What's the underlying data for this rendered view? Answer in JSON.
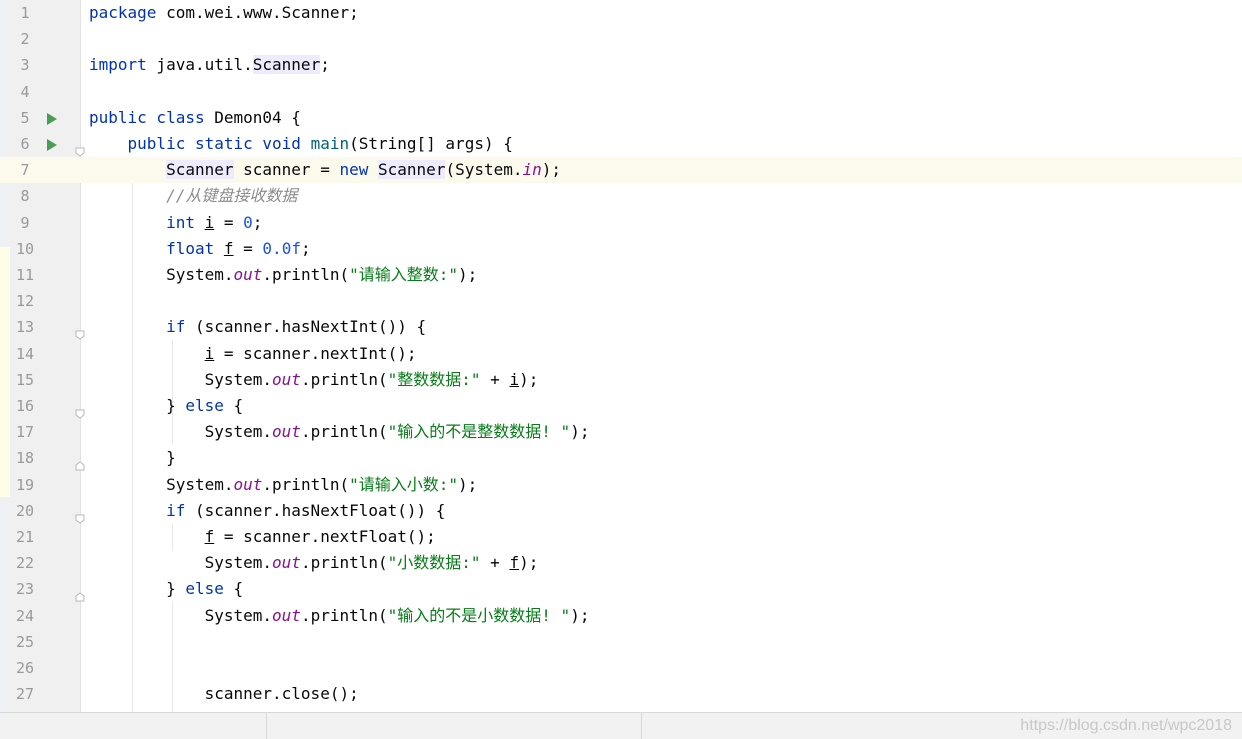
{
  "colors": {
    "keyword": "#0033b3",
    "string": "#067d17",
    "number": "#1750eb",
    "comment": "#8c8c8c",
    "static_field": "#871094",
    "method_decl": "#00627a",
    "plain": "#080808",
    "line_number": "#999999",
    "run_icon": "#499c54",
    "class_ref_bg": "#edebfc",
    "current_line_bg": "#fcfaed"
  },
  "editor": {
    "lines": [
      {
        "number": "1",
        "tokens": [
          {
            "t": "package",
            "c": "kw"
          },
          {
            "t": " com.wei.www.Scanner;"
          }
        ]
      },
      {
        "number": "2",
        "tokens": []
      },
      {
        "number": "3",
        "tokens": [
          {
            "t": "import",
            "c": "kw"
          },
          {
            "t": " java.util."
          },
          {
            "t": "Scanner",
            "c": "cls"
          },
          {
            "t": ";"
          }
        ]
      },
      {
        "number": "4",
        "tokens": []
      },
      {
        "number": "5",
        "run": true,
        "tokens": [
          {
            "t": "public class",
            "c": "kw"
          },
          {
            "t": " Demon04 {"
          }
        ]
      },
      {
        "number": "6",
        "run": true,
        "fold": "open",
        "tokens": [
          {
            "t": "    "
          },
          {
            "t": "public static void",
            "c": "kw"
          },
          {
            "t": " "
          },
          {
            "t": "main",
            "c": "mth"
          },
          {
            "t": "(String[] args) {"
          }
        ]
      },
      {
        "number": "7",
        "current": true,
        "tokens": [
          {
            "t": "        "
          },
          {
            "t": "Scanner",
            "c": "cls"
          },
          {
            "t": " scanner = "
          },
          {
            "t": "new",
            "c": "kw"
          },
          {
            "t": " "
          },
          {
            "t": "Scanner",
            "c": "cls"
          },
          {
            "t": "(System."
          },
          {
            "t": "in",
            "c": "sf"
          },
          {
            "t": ");"
          }
        ]
      },
      {
        "number": "8",
        "tokens": [
          {
            "t": "        "
          },
          {
            "t": "//从键盘接收数据",
            "c": "cm"
          }
        ]
      },
      {
        "number": "9",
        "tokens": [
          {
            "t": "        "
          },
          {
            "t": "int",
            "c": "kw"
          },
          {
            "t": " "
          },
          {
            "t": "i",
            "c": "ul"
          },
          {
            "t": " = "
          },
          {
            "t": "0",
            "c": "num"
          },
          {
            "t": ";"
          }
        ]
      },
      {
        "number": "10",
        "tokens": [
          {
            "t": "        "
          },
          {
            "t": "float",
            "c": "kw"
          },
          {
            "t": " "
          },
          {
            "t": "f",
            "c": "ul"
          },
          {
            "t": " = "
          },
          {
            "t": "0.0f",
            "c": "num"
          },
          {
            "t": ";"
          }
        ]
      },
      {
        "number": "11",
        "tokens": [
          {
            "t": "        System."
          },
          {
            "t": "out",
            "c": "sf"
          },
          {
            "t": ".println("
          },
          {
            "t": "\"请输入整数:\"",
            "c": "str"
          },
          {
            "t": ");"
          }
        ]
      },
      {
        "number": "12",
        "tokens": []
      },
      {
        "number": "13",
        "fold": "open",
        "tokens": [
          {
            "t": "        "
          },
          {
            "t": "if",
            "c": "kw"
          },
          {
            "t": " (scanner.hasNextInt()) {"
          }
        ]
      },
      {
        "number": "14",
        "tokens": [
          {
            "t": "            "
          },
          {
            "t": "i",
            "c": "ul"
          },
          {
            "t": " = scanner.nextInt();"
          }
        ]
      },
      {
        "number": "15",
        "tokens": [
          {
            "t": "            System."
          },
          {
            "t": "out",
            "c": "sf"
          },
          {
            "t": ".println("
          },
          {
            "t": "\"整数数据:\"",
            "c": "str"
          },
          {
            "t": " + "
          },
          {
            "t": "i",
            "c": "ul"
          },
          {
            "t": ");"
          }
        ]
      },
      {
        "number": "16",
        "fold": "open",
        "tokens": [
          {
            "t": "        } "
          },
          {
            "t": "else",
            "c": "kw"
          },
          {
            "t": " {"
          }
        ]
      },
      {
        "number": "17",
        "tokens": [
          {
            "t": "            System."
          },
          {
            "t": "out",
            "c": "sf"
          },
          {
            "t": ".println("
          },
          {
            "t": "\"输入的不是整数数据! \"",
            "c": "str"
          },
          {
            "t": ");"
          }
        ]
      },
      {
        "number": "18",
        "fold": "close",
        "tokens": [
          {
            "t": "        }"
          }
        ]
      },
      {
        "number": "19",
        "tokens": [
          {
            "t": "        System."
          },
          {
            "t": "out",
            "c": "sf"
          },
          {
            "t": ".println("
          },
          {
            "t": "\"请输入小数:\"",
            "c": "str"
          },
          {
            "t": ");"
          }
        ]
      },
      {
        "number": "20",
        "fold": "open",
        "tokens": [
          {
            "t": "        "
          },
          {
            "t": "if",
            "c": "kw"
          },
          {
            "t": " (scanner.hasNextFloat()) {"
          }
        ]
      },
      {
        "number": "21",
        "tokens": [
          {
            "t": "            "
          },
          {
            "t": "f",
            "c": "ul"
          },
          {
            "t": " = scanner.nextFloat();"
          }
        ]
      },
      {
        "number": "22",
        "tokens": [
          {
            "t": "            System."
          },
          {
            "t": "out",
            "c": "sf"
          },
          {
            "t": ".println("
          },
          {
            "t": "\"小数数据:\"",
            "c": "str"
          },
          {
            "t": " + "
          },
          {
            "t": "f",
            "c": "ul"
          },
          {
            "t": ");"
          }
        ]
      },
      {
        "number": "23",
        "fold": "close",
        "tokens": [
          {
            "t": "        } "
          },
          {
            "t": "else",
            "c": "kw"
          },
          {
            "t": " {"
          }
        ]
      },
      {
        "number": "24",
        "tokens": [
          {
            "t": "            System."
          },
          {
            "t": "out",
            "c": "sf"
          },
          {
            "t": ".println("
          },
          {
            "t": "\"输入的不是小数数据! \"",
            "c": "str"
          },
          {
            "t": ");"
          }
        ]
      },
      {
        "number": "25",
        "tokens": []
      },
      {
        "number": "26",
        "tokens": []
      },
      {
        "number": "27",
        "tokens": [
          {
            "t": "            scanner.close();"
          }
        ]
      }
    ]
  },
  "watermark": "https://blog.csdn.net/wpc2018"
}
